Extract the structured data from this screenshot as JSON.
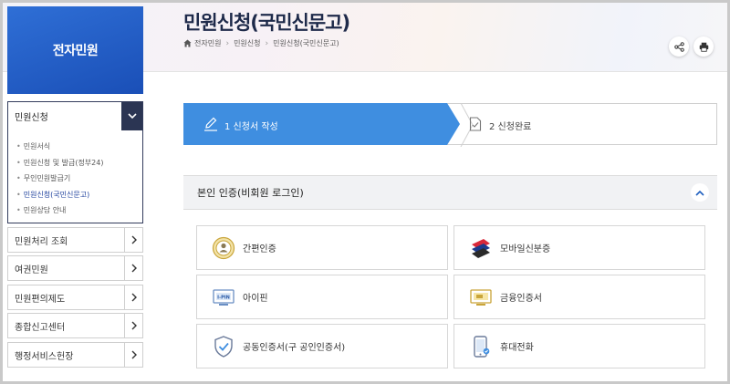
{
  "sidebar": {
    "title": "전자민원",
    "active_menu": "민원신청",
    "submenu": [
      "민원서식",
      "민원신청 및 발급(정부24)",
      "무인민원발급기",
      "민원신청(국민신문고)",
      "민원상담 안내"
    ],
    "items": [
      "민원처리 조회",
      "여권민원",
      "민원편의제도",
      "종합신고센터",
      "행정서비스헌장"
    ]
  },
  "header": {
    "title": "민원신청(국민신문고)",
    "breadcrumb": [
      "전자민원",
      "민원신청",
      "민원신청(국민신문고)"
    ]
  },
  "steps": [
    {
      "label": "1 신청서 작성",
      "active": true
    },
    {
      "label": "2 신청완료",
      "active": false
    }
  ],
  "auth": {
    "title": "본인 인증(비회원 로그인)",
    "options": [
      {
        "label": "간편인증",
        "icon": "simple-auth-icon"
      },
      {
        "label": "모바일신분증",
        "icon": "mobile-id-icon"
      },
      {
        "label": "아이핀",
        "icon": "ipin-icon"
      },
      {
        "label": "금융인증서",
        "icon": "financial-cert-icon"
      },
      {
        "label": "공동인증서(구 공인인증서)",
        "icon": "joint-cert-icon"
      },
      {
        "label": "휴대전화",
        "icon": "mobile-phone-icon"
      }
    ]
  },
  "colors": {
    "brand_blue": "#2a6fd8",
    "step_active": "#3f8ee0",
    "sidebar_dark": "#2b3553"
  }
}
